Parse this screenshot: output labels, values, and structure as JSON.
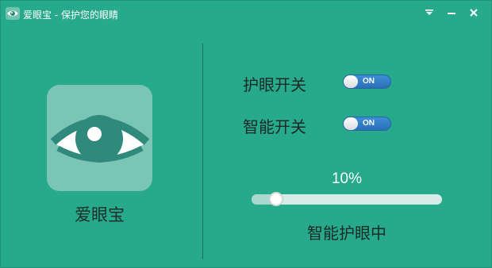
{
  "window": {
    "title": "爱眼宝 - 保护您的眼睛",
    "app_icon": "eye-icon",
    "buttons": [
      "dropdown-icon",
      "minimize-icon",
      "close-icon"
    ]
  },
  "brand": {
    "name": "爱眼宝",
    "logo_icon": "eye-icon"
  },
  "toggles": [
    {
      "label": "护眼开关",
      "state_text": "ON",
      "on": true
    },
    {
      "label": "智能开关",
      "state_text": "ON",
      "on": true
    }
  ],
  "brightness": {
    "value_text": "10%",
    "level_fraction": 0.1
  },
  "status": "智能护眼中",
  "colors": {
    "background": "#26aa8b",
    "toggle_on": "#3d8ed8",
    "logo_bg": "#7bc5b7"
  }
}
